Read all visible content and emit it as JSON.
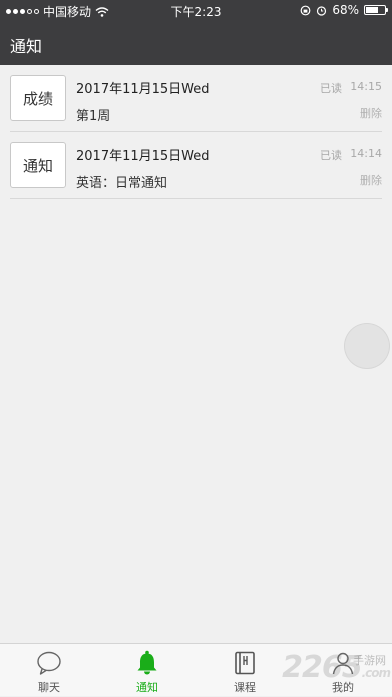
{
  "status_bar": {
    "carrier": "中国移动",
    "time": "下午2:23",
    "battery": "68%",
    "battery_level": 0.68
  },
  "nav": {
    "title": "通知"
  },
  "notifications": [
    {
      "tag": "成绩",
      "date": "2017年11月15日Wed",
      "subtitle": "第1周",
      "read_status": "已读",
      "time": "14:15",
      "delete_label": "删除"
    },
    {
      "tag": "通知",
      "date": "2017年11月15日Wed",
      "subtitle": "英语：日常通知",
      "read_status": "已读",
      "time": "14:14",
      "delete_label": "删除"
    }
  ],
  "tabs": [
    {
      "label": "聊天",
      "icon": "chat-bubble-icon",
      "active": false
    },
    {
      "label": "通知",
      "icon": "bell-icon",
      "active": true
    },
    {
      "label": "课程",
      "icon": "book-icon",
      "active": false
    },
    {
      "label": "我的",
      "icon": "profile-icon",
      "active": false
    }
  ],
  "watermark": {
    "text": "2265",
    "sub": "手游网",
    "suffix": ".com"
  },
  "colors": {
    "header_bg": "#3d3d3f",
    "accent_green": "#1aad19",
    "background": "#f0f0f0"
  }
}
